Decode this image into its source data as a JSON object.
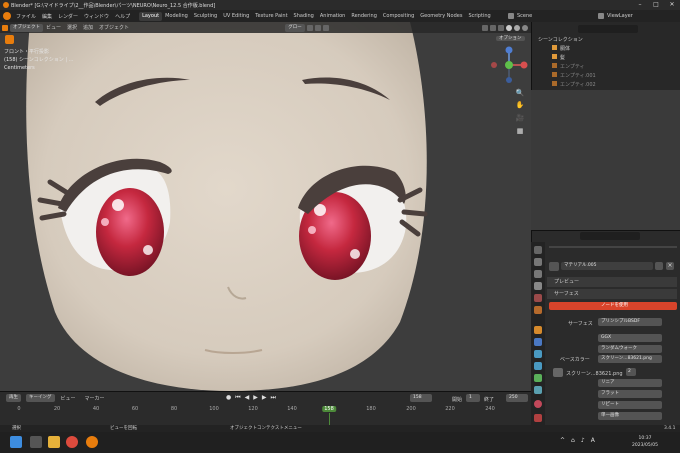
{
  "window": {
    "title": "Blender* [G:\\マイドライブ\\2__作品\\Blender\\パーツ\\NEURO\\Neuro_12.5 合作版.blend]"
  },
  "menu": {
    "items": [
      "ファイル",
      "編集",
      "レンダー",
      "ウィンドウ",
      "ヘルプ"
    ],
    "workspaces": [
      "Layout",
      "Modeling",
      "Sculpting",
      "UV Editing",
      "Texture Paint",
      "Shading",
      "Animation",
      "Rendering",
      "Compositing",
      "Geometry Nodes",
      "Scripting"
    ],
    "active_workspace": "Layout",
    "scene": "Scene",
    "view_layer": "ViewLayer"
  },
  "viewport": {
    "mode": "オブジェクト",
    "menus": [
      "ビュー",
      "選択",
      "追加",
      "オブジェクト"
    ],
    "transform": "グロー",
    "options": "オプション",
    "overlay_lines": [
      "フロント・平行投影",
      "(158) シーンコレクション | ...",
      "Centimeters"
    ]
  },
  "outliner": {
    "header": "シーンコレクション",
    "rows": [
      {
        "label": "胴体",
        "dim": false
      },
      {
        "label": "髪",
        "dim": false
      },
      {
        "label": "エンプティ",
        "dim": true
      },
      {
        "label": "エンプティ.001",
        "dim": true
      },
      {
        "label": "エンプティ.002",
        "dim": true
      }
    ]
  },
  "properties": {
    "search_placeholder": "",
    "material_name": "マテリアル.005",
    "panel_preview": "プレビュー",
    "panel_surface": "サーフェス",
    "use_nodes_button": "ノードを使用",
    "surface_label": "サーフェス",
    "surface_value": "プリンシプルBSDF",
    "ggx": "GGX",
    "random_walk": "ランダムウォーク",
    "base_color_label": "ベースカラー",
    "base_color_value": "スクリーン...83621.png",
    "image_name": "スクリーン...83621.png",
    "image_users": "2",
    "interpolation": "リニア",
    "projection": "フラット",
    "extension": "リピート",
    "alpha": "単一画像"
  },
  "timeline": {
    "menus": [
      "再生",
      "キーイング",
      "ビュー",
      "マーカー"
    ],
    "current_frame": "158",
    "start_label": "開始",
    "start": "1",
    "end_label": "終了",
    "end": "250",
    "ruler": [
      "0",
      "20",
      "40",
      "60",
      "80",
      "100",
      "120",
      "140",
      "158",
      "180",
      "200",
      "220",
      "240"
    ]
  },
  "statusbar": {
    "left": "選択",
    "mid": "ビューを回転",
    "right": "オブジェクトコンテクストメニュー",
    "version": "3.4.1"
  },
  "taskbar": {
    "time": "10:37",
    "date": "2023/05/05"
  },
  "colors": {
    "accent": "#e87d0d",
    "selection": "#334d80",
    "use_nodes_button": "#d9442b",
    "skin": "#dcd1c3"
  }
}
